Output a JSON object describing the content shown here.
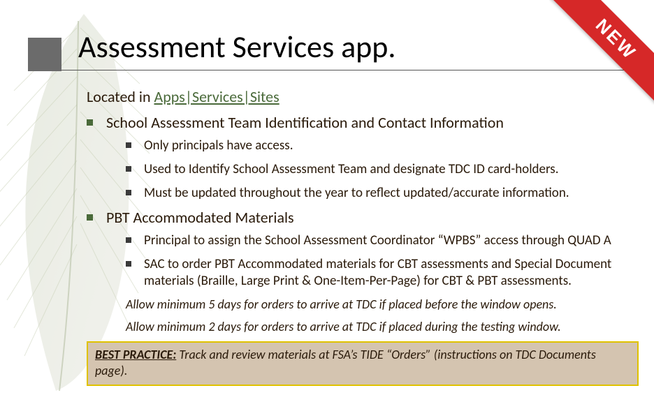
{
  "ribbon": {
    "label": "NEW"
  },
  "title": "Assessment Services app.",
  "located": {
    "prefix": "Located in ",
    "link": "Apps|Services|Sites"
  },
  "sections": [
    {
      "heading": "School Assessment Team Identification and Contact Information",
      "items": [
        "Only principals have access.",
        "Used to Identify School Assessment Team and designate TDC ID card-holders.",
        "Must be updated throughout the year to reflect updated/accurate information."
      ]
    },
    {
      "heading": "PBT Accommodated Materials",
      "items": [
        "Principal to assign the School Assessment Coordinator “WPBS” access through QUAD A",
        "SAC to order PBT Accommodated materials for CBT assessments and Special Document materials (Braille, Large Print & One-Item-Per-Page) for CBT & PBT assessments."
      ]
    }
  ],
  "allow_lines": [
    "Allow minimum 5 days for orders to arrive at TDC if placed before the window opens.",
    "Allow minimum 2 days for orders to arrive at TDC if placed during the testing window."
  ],
  "best_practice": {
    "label": "BEST PRACTICE:",
    "text": " Track and review materials at FSA’s TIDE “Orders” (instructions on TDC Documents page)."
  }
}
